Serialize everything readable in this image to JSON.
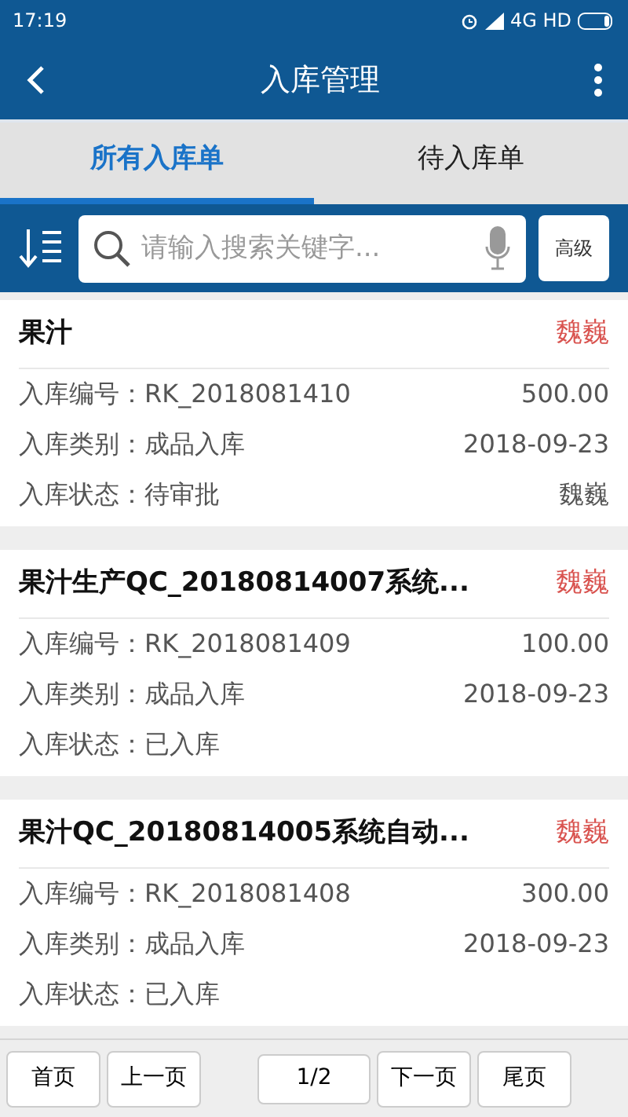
{
  "status_bar": {
    "time": "17:19",
    "network": "4G HD"
  },
  "header": {
    "title": "入库管理"
  },
  "tabs": [
    {
      "label": "所有入库单",
      "selected": true
    },
    {
      "label": "待入库单",
      "selected": false
    }
  ],
  "search": {
    "placeholder": "请输入搜索关键字...",
    "advanced_button": "高级"
  },
  "records": [
    {
      "title": "果汁",
      "person": "魏巍",
      "rows": [
        {
          "label": "入库编号：RK_2018081410",
          "value": "500.00"
        },
        {
          "label": "入库类别：成品入库",
          "value": "2018-09-23"
        },
        {
          "label": "入库状态：待审批",
          "value": "魏巍"
        }
      ]
    },
    {
      "title": "果汁生产QC_20180814007系统...",
      "person": "魏巍",
      "rows": [
        {
          "label": "入库编号：RK_2018081409",
          "value": "100.00"
        },
        {
          "label": "入库类别：成品入库",
          "value": "2018-09-23"
        },
        {
          "label": "入库状态：已入库"
        }
      ]
    },
    {
      "title": "果汁QC_20180814005系统自动...",
      "person": "魏巍",
      "rows": [
        {
          "label": "入库编号：RK_2018081408",
          "value": "300.00"
        },
        {
          "label": "入库类别：成品入库",
          "value": "2018-09-23"
        },
        {
          "label": "入库状态：已入库"
        }
      ]
    }
  ],
  "pagination": {
    "first": "首页",
    "prev": "上一页",
    "page": "1/2",
    "next": "下一页",
    "last": "尾页"
  }
}
